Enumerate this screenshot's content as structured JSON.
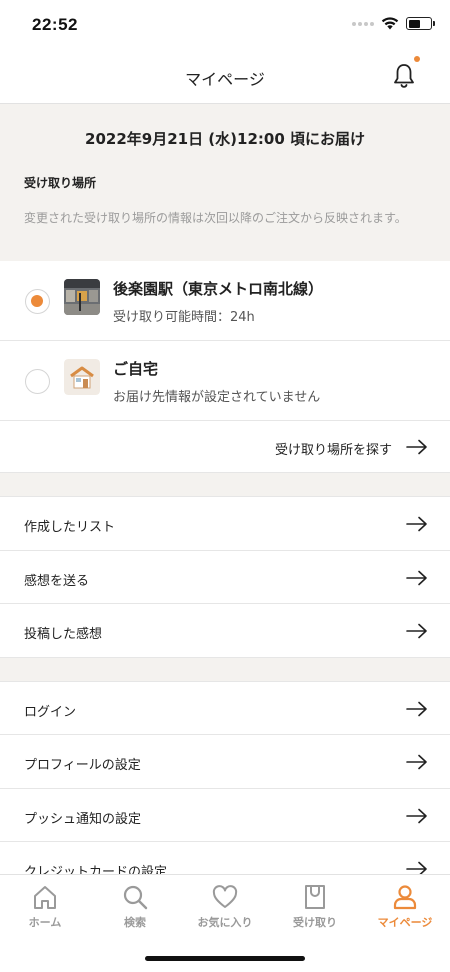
{
  "status": {
    "time": "22:52"
  },
  "nav": {
    "title": "マイページ"
  },
  "delivery": {
    "date": "2022年9月21日 (水)12:00 頃にお届け",
    "pickup_heading": "受け取り場所",
    "pickup_note": "変更された受け取り場所の情報は次回以降のご注文から反映されます。"
  },
  "locations": [
    {
      "name": "後楽園駅（東京メトロ南北線）",
      "sub": "受け取り可能時間：24h",
      "selected": true
    },
    {
      "name": "ご自宅",
      "sub": "お届け先情報が設定されていません",
      "selected": false
    }
  ],
  "find_location": {
    "label": "受け取り場所を探す"
  },
  "menu_group_1": [
    {
      "label": "作成したリスト"
    },
    {
      "label": "感想を送る"
    },
    {
      "label": "投稿した感想"
    }
  ],
  "menu_group_2": [
    {
      "label": "ログイン"
    },
    {
      "label": "プロフィールの設定"
    },
    {
      "label": "プッシュ通知の設定"
    },
    {
      "label": "クレジットカードの設定"
    }
  ],
  "tabs": [
    {
      "label": "ホーム",
      "icon": "home-icon"
    },
    {
      "label": "検索",
      "icon": "search-icon"
    },
    {
      "label": "お気に入り",
      "icon": "heart-icon"
    },
    {
      "label": "受け取り",
      "icon": "bag-icon"
    },
    {
      "label": "マイページ",
      "icon": "person-icon",
      "active": true
    }
  ],
  "colors": {
    "accent": "#ec8a3a",
    "section_bg": "#f4f2ef",
    "inactive_tab": "#9a9a9a"
  }
}
